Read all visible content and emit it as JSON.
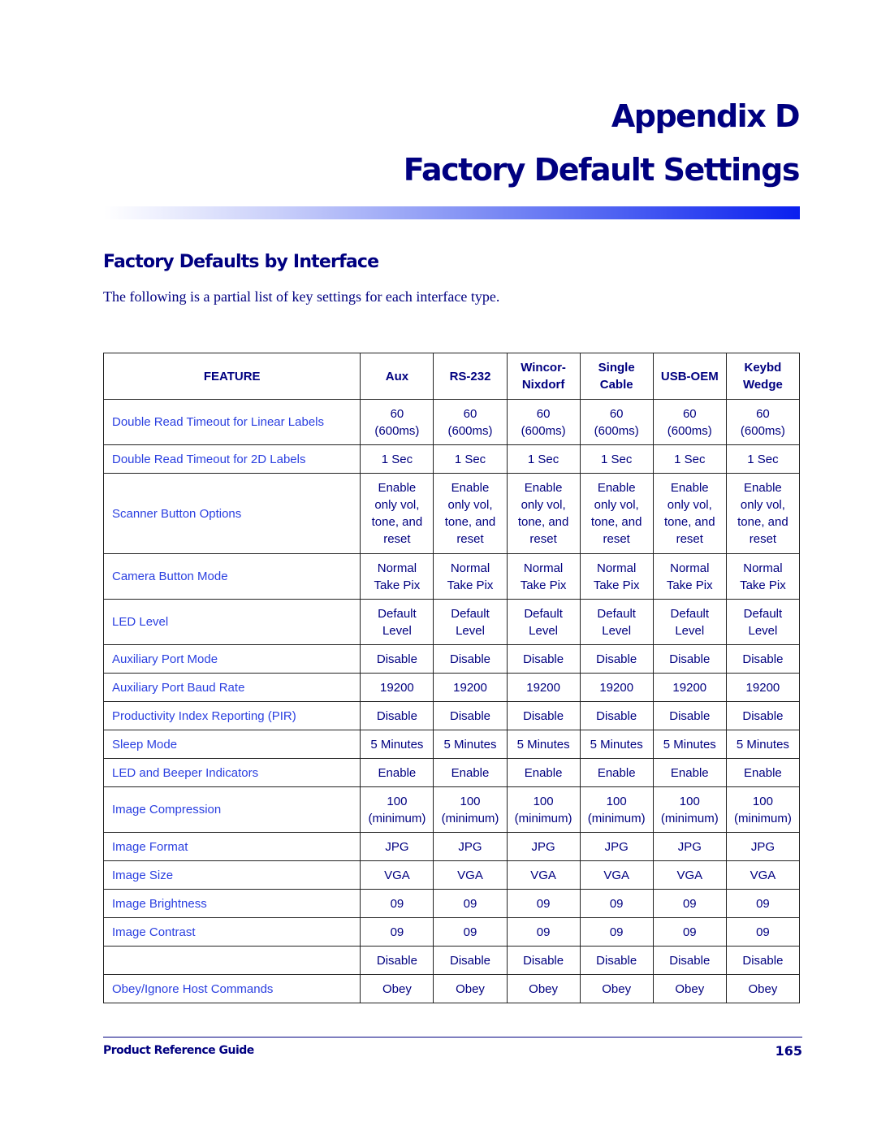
{
  "header": {
    "appendix": "Appendix D",
    "title": "Factory Default Settings"
  },
  "section": {
    "heading": "Factory Defaults by Interface",
    "intro": "The following is a partial list of key settings for each interface type."
  },
  "table": {
    "headers": [
      [
        "FEATURE"
      ],
      [
        "Aux"
      ],
      [
        "RS-232"
      ],
      [
        "Wincor-",
        "Nixdorf"
      ],
      [
        "Single",
        "Cable"
      ],
      [
        "USB-OEM"
      ],
      [
        "Keybd",
        "Wedge"
      ]
    ],
    "rows": [
      {
        "feature": "Double Read Timeout for Linear Labels",
        "values": [
          [
            "60",
            "(600ms)"
          ],
          [
            "60",
            "(600ms)"
          ],
          [
            "60",
            "(600ms)"
          ],
          [
            "60",
            "(600ms)"
          ],
          [
            "60",
            "(600ms)"
          ],
          [
            "60",
            "(600ms)"
          ]
        ]
      },
      {
        "feature": "Double Read Timeout for 2D Labels",
        "values": [
          [
            "1 Sec"
          ],
          [
            "1 Sec"
          ],
          [
            "1 Sec"
          ],
          [
            "1 Sec"
          ],
          [
            "1 Sec"
          ],
          [
            "1 Sec"
          ]
        ]
      },
      {
        "feature": "Scanner Button Options",
        "values": [
          [
            "Enable",
            "only vol,",
            "tone, and",
            "reset"
          ],
          [
            "Enable",
            "only vol,",
            "tone, and",
            "reset"
          ],
          [
            "Enable",
            "only vol,",
            "tone, and",
            "reset"
          ],
          [
            "Enable",
            "only vol,",
            "tone, and",
            "reset"
          ],
          [
            "Enable",
            "only vol,",
            "tone, and",
            "reset"
          ],
          [
            "Enable",
            "only vol,",
            "tone, and",
            "reset"
          ]
        ]
      },
      {
        "feature": "Camera Button Mode",
        "values": [
          [
            "Normal",
            "Take Pix"
          ],
          [
            "Normal",
            "Take Pix"
          ],
          [
            "Normal",
            "Take Pix"
          ],
          [
            "Normal",
            "Take Pix"
          ],
          [
            "Normal",
            "Take Pix"
          ],
          [
            "Normal",
            "Take Pix"
          ]
        ]
      },
      {
        "feature": "LED Level",
        "values": [
          [
            "Default",
            "Level"
          ],
          [
            "Default",
            "Level"
          ],
          [
            "Default",
            "Level"
          ],
          [
            "Default",
            "Level"
          ],
          [
            "Default",
            "Level"
          ],
          [
            "Default",
            "Level"
          ]
        ]
      },
      {
        "feature": "Auxiliary Port Mode",
        "values": [
          [
            "Disable"
          ],
          [
            "Disable"
          ],
          [
            "Disable"
          ],
          [
            "Disable"
          ],
          [
            "Disable"
          ],
          [
            "Disable"
          ]
        ]
      },
      {
        "feature": "Auxiliary Port Baud Rate",
        "values": [
          [
            "19200"
          ],
          [
            "19200"
          ],
          [
            "19200"
          ],
          [
            "19200"
          ],
          [
            "19200"
          ],
          [
            "19200"
          ]
        ]
      },
      {
        "feature": "Productivity Index Reporting (PIR)",
        "values": [
          [
            "Disable"
          ],
          [
            "Disable"
          ],
          [
            "Disable"
          ],
          [
            "Disable"
          ],
          [
            "Disable"
          ],
          [
            "Disable"
          ]
        ]
      },
      {
        "feature": "Sleep Mode",
        "values": [
          [
            "5 Minutes"
          ],
          [
            "5 Minutes"
          ],
          [
            "5 Minutes"
          ],
          [
            "5 Minutes"
          ],
          [
            "5 Minutes"
          ],
          [
            "5 Minutes"
          ]
        ]
      },
      {
        "feature": "LED and Beeper Indicators",
        "values": [
          [
            "Enable"
          ],
          [
            "Enable"
          ],
          [
            "Enable"
          ],
          [
            "Enable"
          ],
          [
            "Enable"
          ],
          [
            "Enable"
          ]
        ]
      },
      {
        "feature": "Image Compression",
        "values": [
          [
            "100",
            "(minimum)"
          ],
          [
            "100",
            "(minimum)"
          ],
          [
            "100",
            "(minimum)"
          ],
          [
            "100",
            "(minimum)"
          ],
          [
            "100",
            "(minimum)"
          ],
          [
            "100",
            "(minimum)"
          ]
        ]
      },
      {
        "feature": "Image Format",
        "values": [
          [
            "JPG"
          ],
          [
            "JPG"
          ],
          [
            "JPG"
          ],
          [
            "JPG"
          ],
          [
            "JPG"
          ],
          [
            "JPG"
          ]
        ]
      },
      {
        "feature": "Image Size",
        "values": [
          [
            "VGA"
          ],
          [
            "VGA"
          ],
          [
            "VGA"
          ],
          [
            "VGA"
          ],
          [
            "VGA"
          ],
          [
            "VGA"
          ]
        ]
      },
      {
        "feature": "Image Brightness",
        "values": [
          [
            "09"
          ],
          [
            "09"
          ],
          [
            "09"
          ],
          [
            "09"
          ],
          [
            "09"
          ],
          [
            "09"
          ]
        ]
      },
      {
        "feature": "Image Contrast",
        "values": [
          [
            "09"
          ],
          [
            "09"
          ],
          [
            "09"
          ],
          [
            "09"
          ],
          [
            "09"
          ],
          [
            "09"
          ]
        ]
      },
      {
        "feature": "",
        "values": [
          [
            "Disable"
          ],
          [
            "Disable"
          ],
          [
            "Disable"
          ],
          [
            "Disable"
          ],
          [
            "Disable"
          ],
          [
            "Disable"
          ]
        ]
      },
      {
        "feature": "Obey/Ignore Host Commands",
        "values": [
          [
            "Obey"
          ],
          [
            "Obey"
          ],
          [
            "Obey"
          ],
          [
            "Obey"
          ],
          [
            "Obey"
          ],
          [
            "Obey"
          ]
        ]
      }
    ]
  },
  "footer": {
    "guide": "Product Reference Guide",
    "page_number": "165"
  },
  "colors": {
    "title": "#000080",
    "link": "#2a3fe0",
    "bar_end": "#0a1fef"
  }
}
